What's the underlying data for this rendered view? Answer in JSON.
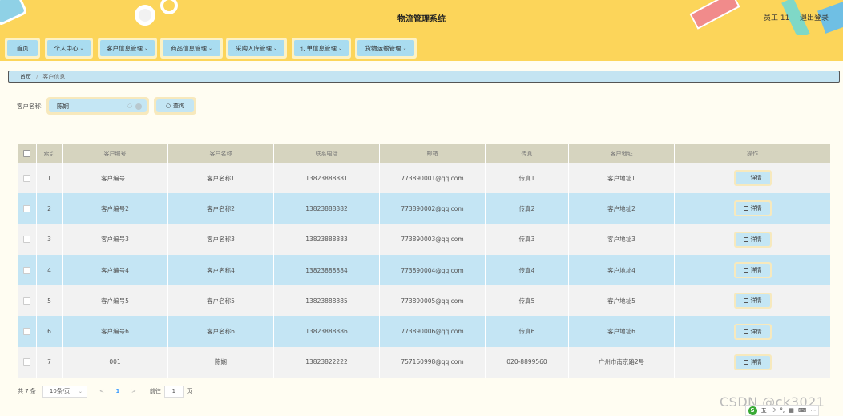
{
  "header": {
    "title": "物流管理系统",
    "user": "员工 11",
    "logout": "退出登录"
  },
  "nav": [
    {
      "label": "首页",
      "dropdown": false
    },
    {
      "label": "个人中心",
      "dropdown": true
    },
    {
      "label": "客户信息管理",
      "dropdown": true
    },
    {
      "label": "商品信息管理",
      "dropdown": true
    },
    {
      "label": "采购入库管理",
      "dropdown": true
    },
    {
      "label": "订单信息管理",
      "dropdown": true
    },
    {
      "label": "货物运输管理",
      "dropdown": true
    }
  ],
  "breadcrumb": {
    "home": "首页",
    "separator": "/",
    "current": "客户信息"
  },
  "search": {
    "label": "客户名称:",
    "value": "陈娴",
    "button": "查询"
  },
  "table": {
    "columns": [
      "索引",
      "客户编号",
      "客户名称",
      "联系电话",
      "邮箱",
      "传真",
      "客户地址",
      "操作"
    ],
    "detail_label": "详情",
    "rows": [
      {
        "index": "1",
        "no": "客户编号1",
        "name": "客户名称1",
        "tel": "13823888881",
        "mail": "773890001@qq.com",
        "fax": "传真1",
        "addr": "客户地址1"
      },
      {
        "index": "2",
        "no": "客户编号2",
        "name": "客户名称2",
        "tel": "13823888882",
        "mail": "773890002@qq.com",
        "fax": "传真2",
        "addr": "客户地址2"
      },
      {
        "index": "3",
        "no": "客户编号3",
        "name": "客户名称3",
        "tel": "13823888883",
        "mail": "773890003@qq.com",
        "fax": "传真3",
        "addr": "客户地址3"
      },
      {
        "index": "4",
        "no": "客户编号4",
        "name": "客户名称4",
        "tel": "13823888884",
        "mail": "773890004@qq.com",
        "fax": "传真4",
        "addr": "客户地址4"
      },
      {
        "index": "5",
        "no": "客户编号5",
        "name": "客户名称5",
        "tel": "13823888885",
        "mail": "773890005@qq.com",
        "fax": "传真5",
        "addr": "客户地址5"
      },
      {
        "index": "6",
        "no": "客户编号6",
        "name": "客户名称6",
        "tel": "13823888886",
        "mail": "773890006@qq.com",
        "fax": "传真6",
        "addr": "客户地址6"
      },
      {
        "index": "7",
        "no": "001",
        "name": "陈娴",
        "tel": "13823822222",
        "mail": "757160998@qq.com",
        "fax": "020-8899560",
        "addr": "广州市南京路2号"
      }
    ]
  },
  "pager": {
    "total": "共 7 条",
    "page_size": "10条/页",
    "prev": "<",
    "current": "1",
    "next": ">",
    "goto": "前往",
    "jump_value": "1",
    "page_unit": "页"
  },
  "watermark": "CSDN @ck3021",
  "ime": {
    "brand": "S",
    "items": [
      "五",
      "☽",
      "°,",
      "▦",
      "⌨",
      "⋯"
    ]
  },
  "colors": {
    "header_bg": "#fcd55a",
    "nav_inner": "#a9dcf0",
    "row_alt": "#c4e5f4",
    "row_base": "#f2f2f2",
    "table_head": "#d6d4bf"
  }
}
